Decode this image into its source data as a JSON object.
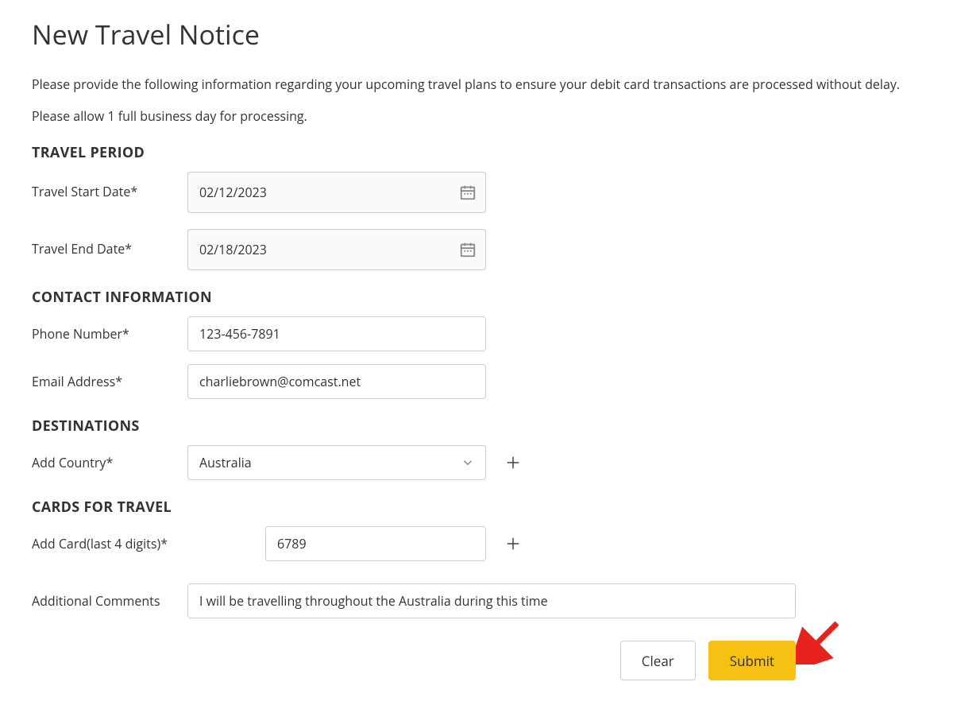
{
  "page": {
    "title": "New Travel Notice",
    "intro1": "Please provide the following information regarding your upcoming travel plans to ensure your debit card transactions are processed without delay.",
    "intro2": "Please allow 1 full business day for processing."
  },
  "sections": {
    "travel_period": {
      "heading": "TRAVEL PERIOD",
      "start_label": "Travel Start Date*",
      "start_value": "02/12/2023",
      "end_label": "Travel End Date*",
      "end_value": "02/18/2023"
    },
    "contact": {
      "heading": "CONTACT INFORMATION",
      "phone_label": "Phone Number*",
      "phone_value": "123-456-7891",
      "email_label": "Email Address*",
      "email_value": "charliebrown@comcast.net"
    },
    "destinations": {
      "heading": "DESTINATIONS",
      "country_label": "Add Country*",
      "country_value": "Australia"
    },
    "cards": {
      "heading": "CARDS FOR TRAVEL",
      "card_label": "Add Card(last 4 digits)*",
      "card_value": "6789"
    },
    "comments": {
      "label": "Additional Comments",
      "value": "I will be travelling throughout the Australia during this time"
    }
  },
  "buttons": {
    "clear": "Clear",
    "submit": "Submit"
  }
}
